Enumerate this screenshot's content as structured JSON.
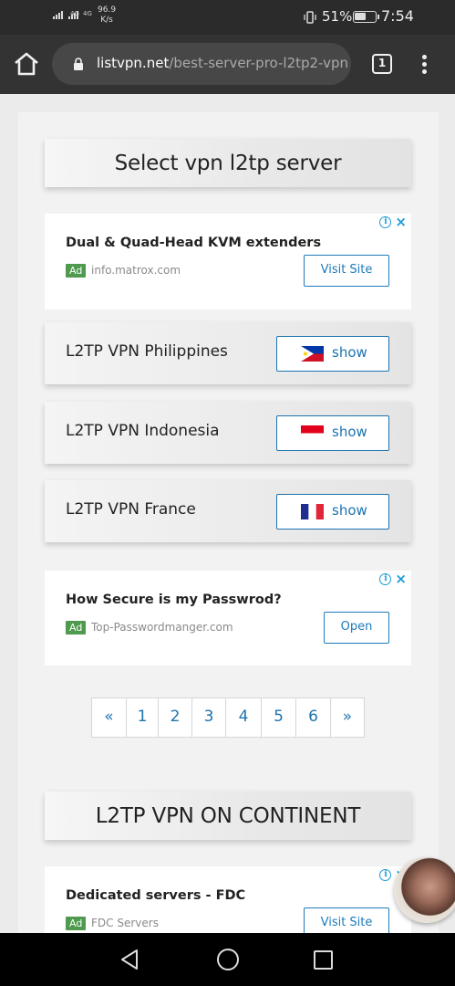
{
  "status_bar": {
    "network_label": "4G",
    "network_label_2": "4G",
    "speed_value": "96.9",
    "speed_unit": "K/s",
    "battery_percent": "51%",
    "time": "7:54",
    "icons": [
      "signal-icon",
      "vibrate-icon",
      "battery-icon"
    ]
  },
  "browser": {
    "url_domain": "listvpn.net",
    "url_path": "/best-server-pro-l2tp2-vpn",
    "tab_count": "1",
    "icons": [
      "home-icon",
      "lock-icon",
      "tab-switcher-icon",
      "overflow-menu-icon"
    ]
  },
  "page": {
    "heading": "Select vpn l2tp server",
    "ads": [
      {
        "title": "Dual & Quad-Head KVM extenders",
        "badge": "Ad",
        "domain": "info.matrox.com",
        "button": "Visit Site"
      },
      {
        "title": "How Secure is my Passwrod?",
        "badge": "Ad",
        "domain": "Top-Passwordmanger.com",
        "button": "Open"
      },
      {
        "title": "Dedicated servers - FDC",
        "badge": "Ad",
        "domain": "FDC Servers",
        "button": "Visit Site"
      }
    ],
    "servers": [
      {
        "name": "L2TP VPN Philippines",
        "button": "show",
        "flag": "philippines-flag-icon"
      },
      {
        "name": "L2TP VPN Indonesia",
        "button": "show",
        "flag": "indonesia-flag-icon"
      },
      {
        "name": "L2TP VPN France",
        "button": "show",
        "flag": "france-flag-icon"
      }
    ],
    "pagination": [
      "«",
      "1",
      "2",
      "3",
      "4",
      "5",
      "6",
      "»"
    ],
    "section_heading": "L2TP VPN ON CONTINENT"
  },
  "colors": {
    "link_blue": "#1d73b0",
    "ad_green": "#4f9a4f",
    "toolbar": "#333333"
  }
}
